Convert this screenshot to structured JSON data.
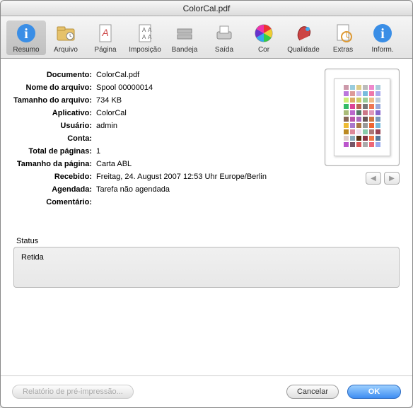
{
  "window": {
    "title": "ColorCal.pdf"
  },
  "toolbar": {
    "items": [
      {
        "label": "Resumo",
        "icon": "info"
      },
      {
        "label": "Arquivo",
        "icon": "folder"
      },
      {
        "label": "Página",
        "icon": "page"
      },
      {
        "label": "Imposição",
        "icon": "impose"
      },
      {
        "label": "Bandeja",
        "icon": "tray"
      },
      {
        "label": "Saída",
        "icon": "output"
      },
      {
        "label": "Cor",
        "icon": "color"
      },
      {
        "label": "Qualidade",
        "icon": "quality"
      },
      {
        "label": "Extras",
        "icon": "extras"
      },
      {
        "label": "Inform.",
        "icon": "inform"
      }
    ],
    "selected_index": 0
  },
  "info": {
    "rows": [
      {
        "label": "Documento:",
        "value": "ColorCal.pdf"
      },
      {
        "label": "Nome do arquivo:",
        "value": "Spool 00000014"
      },
      {
        "label": "Tamanho do arquivo:",
        "value": "734 KB"
      },
      {
        "label": "Aplicativo:",
        "value": "ColorCal"
      },
      {
        "label": "Usuário:",
        "value": "admin"
      },
      {
        "label": "Conta:",
        "value": ""
      },
      {
        "label": "Total de páginas:",
        "value": "1"
      },
      {
        "label": "Tamanho da página:",
        "value": "Carta ABL"
      },
      {
        "label": "Recebido:",
        "value": "Freitag, 24. August 2007 12:53 Uhr Europe/Berlin"
      },
      {
        "label": "Agendada:",
        "value": "Tarefa não agendada"
      },
      {
        "label": "Comentário:",
        "value": ""
      }
    ]
  },
  "status": {
    "label": "Status",
    "value": "Retida"
  },
  "footer": {
    "report_button": "Relatório de pré-impressão...",
    "cancel_button": "Cancelar",
    "ok_button": "OK"
  },
  "preview": {
    "swatches": [
      "#c9a",
      "#9cd",
      "#dc8",
      "#bbb",
      "#e8c",
      "#acd",
      "#b7d",
      "#d99",
      "#cbe",
      "#7bd",
      "#e7a",
      "#aae",
      "#ce7",
      "#da6",
      "#cc6",
      "#9c9",
      "#eb8",
      "#bcd",
      "#3b6",
      "#d49",
      "#b65",
      "#777",
      "#e75",
      "#9ad",
      "#ab7",
      "#b6c",
      "#576",
      "#c78",
      "#d9b",
      "#86c",
      "#865",
      "#b5a",
      "#a6b",
      "#655",
      "#c74",
      "#79b",
      "#eb3",
      "#a7c",
      "#a74",
      "#999",
      "#e63",
      "#7bd",
      "#b82",
      "#d89",
      "#ede",
      "#8ca",
      "#a77",
      "#945",
      "#dcc",
      "#8ab",
      "#531",
      "#834",
      "#e74",
      "#579",
      "#b5c",
      "#756",
      "#d55",
      "#aaa",
      "#e67",
      "#9ae"
    ]
  }
}
